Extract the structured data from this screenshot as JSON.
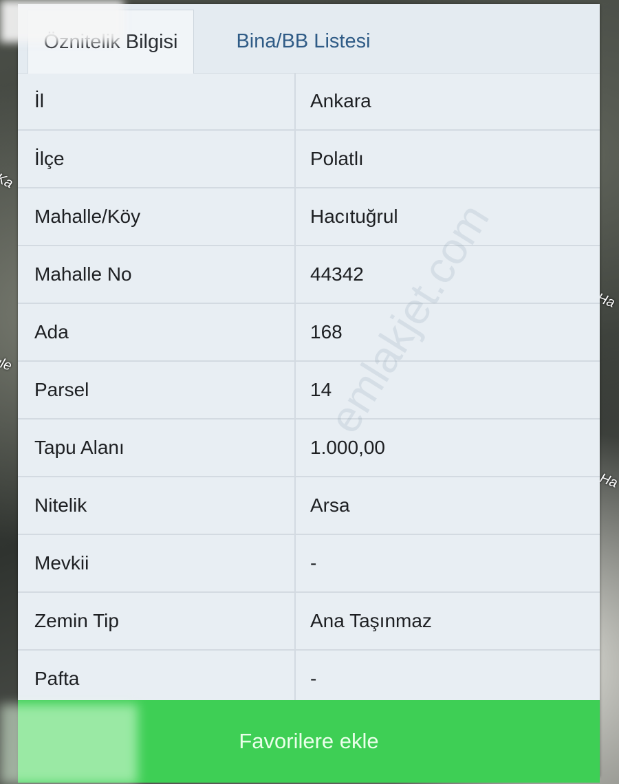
{
  "map": {
    "labels": [
      "Ka",
      "Ha",
      "ule",
      "Ha"
    ]
  },
  "tabs": {
    "active_label": "Öznitelik Bilgisi",
    "inactive_label": "Bina/BB Listesi"
  },
  "table": {
    "rows": [
      {
        "key": "İl",
        "value": "Ankara"
      },
      {
        "key": "İlçe",
        "value": "Polatlı"
      },
      {
        "key": "Mahalle/Köy",
        "value": "Hacıtuğrul"
      },
      {
        "key": "Mahalle No",
        "value": "44342"
      },
      {
        "key": "Ada",
        "value": "168"
      },
      {
        "key": "Parsel",
        "value": "14"
      },
      {
        "key": "Tapu Alanı",
        "value": "1.000,00"
      },
      {
        "key": "Nitelik",
        "value": "Arsa"
      },
      {
        "key": "Mevkii",
        "value": "-"
      },
      {
        "key": "Zemin Tip",
        "value": "Ana Taşınmaz"
      },
      {
        "key": "Pafta",
        "value": "-"
      }
    ]
  },
  "actions": {
    "favorite_label": "Favorilere ekle"
  },
  "watermark": "emlakjet.com",
  "colors": {
    "button_green": "#3ecf55",
    "tab_link_blue": "#2f5b86",
    "panel_bg": "#e8eef3"
  }
}
